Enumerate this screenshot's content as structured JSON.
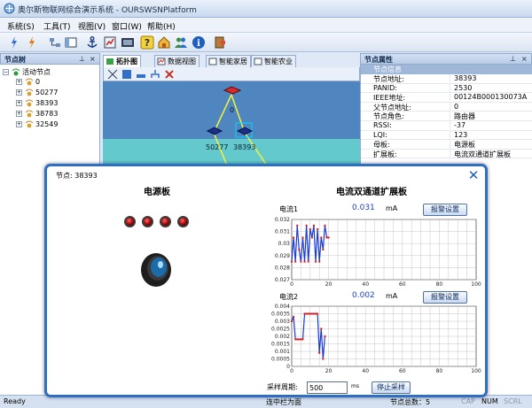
{
  "window": {
    "title": "奥尔斯物联网综合演示系统 - OURSWSNPlatform"
  },
  "menu": [
    "系统(S)",
    "工具(T)",
    "视图(V)",
    "窗口(W)",
    "帮助(H)"
  ],
  "node_tree": {
    "title": "节点树",
    "root": "活动节点",
    "nodes": [
      "0",
      "50277",
      "38393",
      "38783",
      "32549"
    ]
  },
  "center_tabs": [
    "拓扑图",
    "数据视图",
    "智能家居",
    "智能农业"
  ],
  "topology": {
    "labels": [
      "0",
      "50277",
      "38393"
    ]
  },
  "properties": {
    "title": "节点属性",
    "group": "节点信息",
    "rows": [
      {
        "k": "节点地址:",
        "v": "38393"
      },
      {
        "k": "PANID:",
        "v": "2530"
      },
      {
        "k": "IEEE地址:",
        "v": "00124B000130073A"
      },
      {
        "k": "父节点地址:",
        "v": "0"
      },
      {
        "k": "节点角色:",
        "v": "路由器"
      },
      {
        "k": "RSSI:",
        "v": "-37"
      },
      {
        "k": "LQI:",
        "v": "123"
      },
      {
        "k": "母板:",
        "v": "电源板"
      },
      {
        "k": "扩展板:",
        "v": "电流双通道扩展板"
      }
    ]
  },
  "status": {
    "left": "Ready",
    "center1": "连中栏为面",
    "center2": "节点总数：5",
    "caps": "CAP",
    "num": "NUM",
    "scrl": "SCRL"
  },
  "dialog": {
    "node": "节点: 38393",
    "left_title": "电源板",
    "right_title": "电流双通道扩展板",
    "channel1": {
      "label": "电流1",
      "value": "0.031",
      "unit": "mA",
      "button": "报警设置"
    },
    "channel2": {
      "label": "电流2",
      "value": "0.002",
      "unit": "mA",
      "button": "报警设置"
    },
    "sample_label": "采样周期:",
    "sample_value": "500",
    "sample_unit": "ms",
    "stop_button": "停止采样"
  },
  "chart_data": [
    {
      "type": "line",
      "title": "电流1",
      "xlim": [
        0,
        100
      ],
      "ylim": [
        0.027,
        0.032
      ],
      "x_ticks": [
        0,
        20,
        40,
        60,
        80,
        100
      ],
      "y_ticks": [
        0.027,
        0.028,
        0.029,
        0.03,
        0.031,
        0.032
      ],
      "series_color": "#1a3ad6",
      "marker_color": "#e01818",
      "x": [
        0,
        1,
        2,
        3,
        4,
        5,
        6,
        7,
        8,
        9,
        10,
        11,
        12,
        13,
        14,
        15,
        16,
        17,
        18,
        19,
        20
      ],
      "y": [
        0.0285,
        0.0305,
        0.0285,
        0.0315,
        0.0295,
        0.0285,
        0.0305,
        0.0285,
        0.0315,
        0.0285,
        0.0312,
        0.0305,
        0.0315,
        0.0285,
        0.0312,
        0.0285,
        0.0305,
        0.0295,
        0.0315,
        0.0305,
        0.0305
      ]
    },
    {
      "type": "line",
      "title": "电流2",
      "xlim": [
        0,
        100
      ],
      "ylim": [
        0,
        0.004
      ],
      "x_ticks": [
        0,
        20,
        40,
        60,
        80,
        100
      ],
      "y_ticks": [
        0,
        0.0005,
        0.001,
        0.0015,
        0.002,
        0.0025,
        0.003,
        0.0035,
        0.004
      ],
      "series_color": "#1a3ad6",
      "marker_color": "#e01818",
      "x": [
        0,
        1,
        2,
        3,
        4,
        5,
        6,
        7,
        8,
        9,
        10,
        11,
        12,
        13,
        14,
        15,
        16,
        17,
        18
      ],
      "y": [
        0.003,
        0.0033,
        0.0018,
        0.0018,
        0.0018,
        0.0018,
        0.0018,
        0.0035,
        0.0035,
        0.0035,
        0.0035,
        0.0035,
        0.0035,
        0.0035,
        0.0035,
        0.0009,
        0.0025,
        0.0005,
        0.002
      ]
    }
  ]
}
